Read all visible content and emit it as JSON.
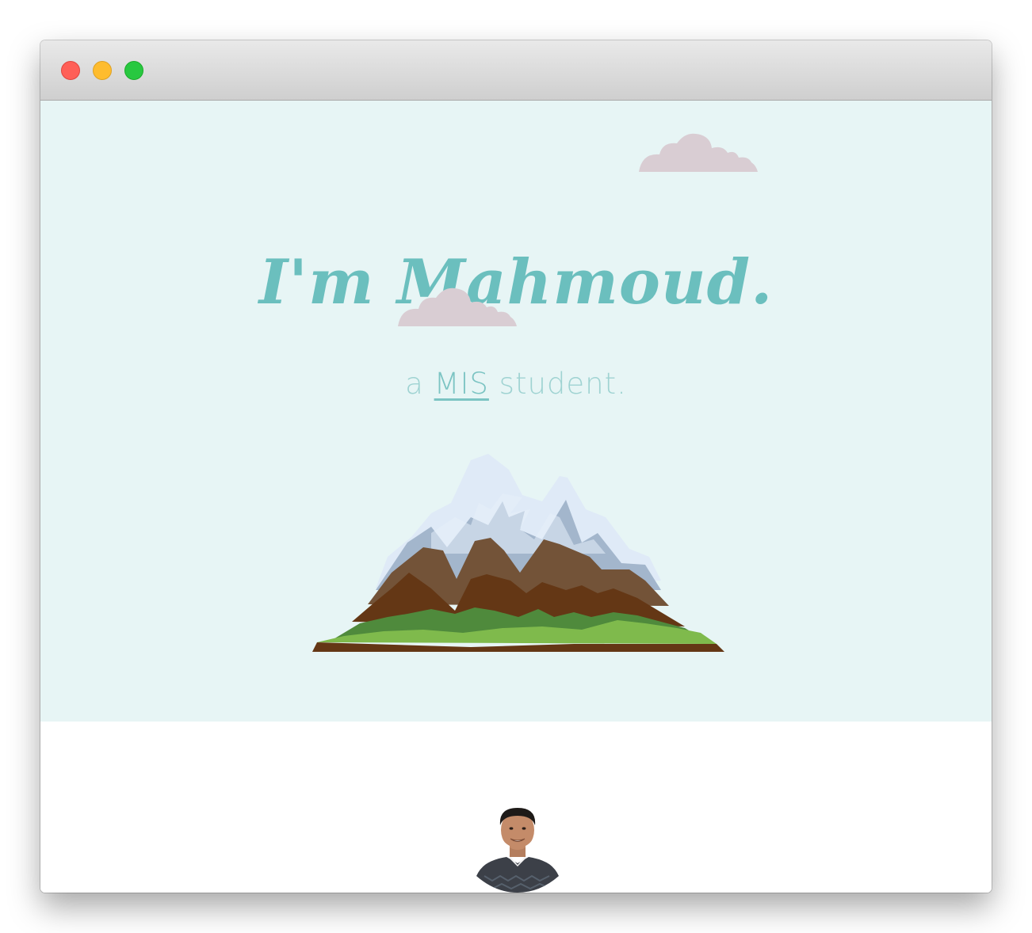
{
  "window": {
    "controls": [
      "close",
      "minimize",
      "maximize"
    ],
    "colors": {
      "close": "#ff5f57",
      "minimize": "#febc2e",
      "maximize": "#28c840"
    }
  },
  "hero": {
    "title": "I'm Mahmoud.",
    "subtitle_prefix": "a",
    "subtitle_link": "MIS",
    "subtitle_suffix": "student.",
    "background": "#e7f5f5",
    "accent": "#6bbfbe",
    "illustration": "mountain-illustration",
    "clouds": [
      "cloud-icon",
      "cloud-icon"
    ]
  },
  "about": {
    "avatar": "profile-photo"
  }
}
